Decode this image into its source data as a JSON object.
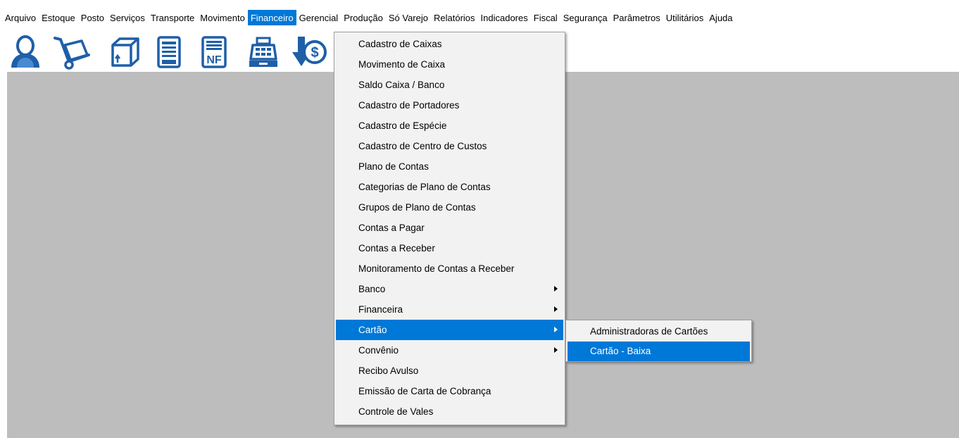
{
  "colors": {
    "accent": "#0078d7",
    "icon_blue": "#1e5fa8",
    "workspace": "#bdbdbd",
    "menu_bg": "#f2f2f2"
  },
  "menubar": {
    "items": [
      {
        "label": "Arquivo"
      },
      {
        "label": "Estoque"
      },
      {
        "label": "Posto"
      },
      {
        "label": "Serviços"
      },
      {
        "label": "Transporte"
      },
      {
        "label": "Movimento"
      },
      {
        "label": "Financeiro",
        "active": true
      },
      {
        "label": "Gerencial"
      },
      {
        "label": "Produção"
      },
      {
        "label": "Só Varejo"
      },
      {
        "label": "Relatórios"
      },
      {
        "label": "Indicadores"
      },
      {
        "label": "Fiscal"
      },
      {
        "label": "Segurança"
      },
      {
        "label": "Parâmetros"
      },
      {
        "label": "Utilitários"
      },
      {
        "label": "Ajuda"
      }
    ]
  },
  "toolbar": {
    "buttons": [
      {
        "icon": "user-icon"
      },
      {
        "icon": "hand-truck-icon"
      },
      {
        "icon": "box-icon"
      },
      {
        "icon": "document-icon"
      },
      {
        "icon": "nf-document-icon",
        "text": "NF"
      },
      {
        "icon": "cash-register-icon"
      },
      {
        "icon": "money-down-arrow-icon",
        "text": "$"
      }
    ]
  },
  "financeiro_menu": {
    "items": [
      {
        "label": "Cadastro de Caixas"
      },
      {
        "label": "Movimento de Caixa"
      },
      {
        "label": "Saldo Caixa / Banco"
      },
      {
        "label": "Cadastro de Portadores"
      },
      {
        "label": "Cadastro de Espécie"
      },
      {
        "label": "Cadastro de Centro de Custos"
      },
      {
        "label": "Plano de Contas"
      },
      {
        "label": "Categorias de Plano de Contas"
      },
      {
        "label": "Grupos de Plano de Contas"
      },
      {
        "label": "Contas a Pagar"
      },
      {
        "label": "Contas a Receber"
      },
      {
        "label": "Monitoramento de Contas a Receber"
      },
      {
        "label": "Banco",
        "submenu": true
      },
      {
        "label": "Financeira",
        "submenu": true
      },
      {
        "label": "Cartão",
        "submenu": true,
        "selected": true
      },
      {
        "label": "Convênio",
        "submenu": true
      },
      {
        "label": "Recibo Avulso"
      },
      {
        "label": "Emissão de Carta de Cobrança"
      },
      {
        "label": "Controle de Vales"
      }
    ]
  },
  "cartao_submenu": {
    "items": [
      {
        "label": "Administradoras de Cartões"
      },
      {
        "label": "Cartão - Baixa",
        "selected": true
      }
    ]
  }
}
